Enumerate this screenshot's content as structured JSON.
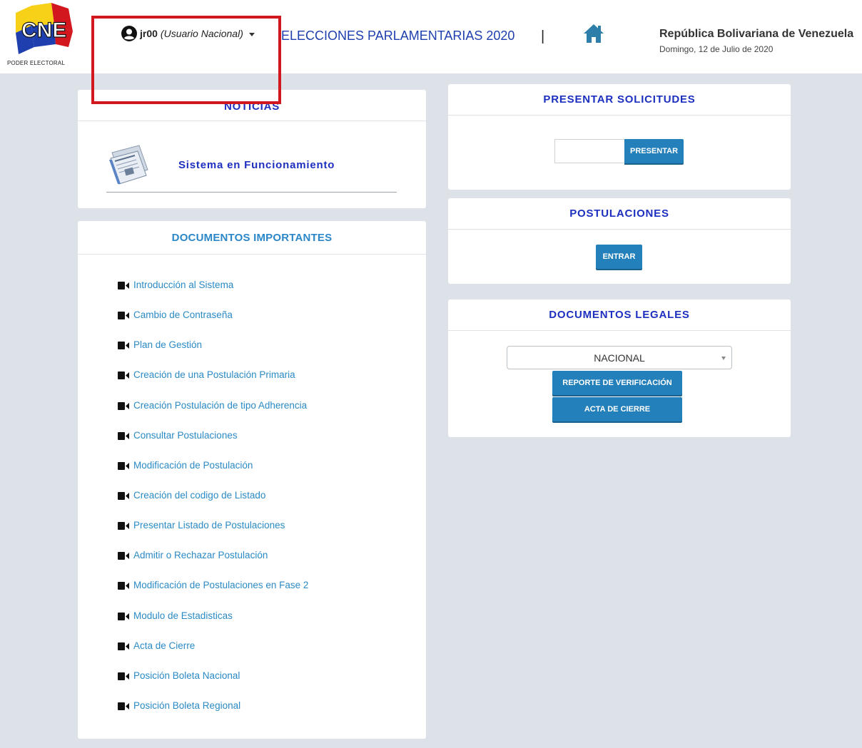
{
  "header": {
    "logo_text": "CNE",
    "logo_subtext": "PODER ELECTORAL",
    "user_name": "jr00",
    "user_role": "(Usuario Nacional)",
    "app_title": "ELECCIONES PARLAMENTARIAS 2020",
    "separator": "|",
    "country": "República Bolivariana de Venezuela",
    "date": "Domingo, 12 de Julio de 2020"
  },
  "noticias": {
    "title": "NOTICIAS",
    "item": "Sistema en Funcionamiento"
  },
  "documentos": {
    "title": "DOCUMENTOS IMPORTANTES",
    "items": [
      "Introducción al Sistema",
      "Cambio de Contraseña",
      "Plan de Gestión",
      "Creación de una Postulación Primaria",
      "Creación Postulación de tipo Adherencia",
      "Consultar Postulaciones",
      "Modificación de Postulación",
      "Creación del codigo de Listado",
      "Presentar Listado de Postulaciones",
      "Admitir o Rechazar Postulación",
      "Modificación de Postulaciones en Fase 2",
      "Modulo de Estadisticas",
      "Acta de Cierre",
      "Posición Boleta Nacional",
      "Posición Boleta Regional"
    ]
  },
  "solicitudes": {
    "title": "PRESENTAR SOLICITUDES",
    "input_value": "",
    "button": "PRESENTAR"
  },
  "postulaciones": {
    "title": "POSTULACIONES",
    "button": "ENTRAR"
  },
  "legales": {
    "title": "DOCUMENTOS LEGALES",
    "select_value": "NACIONAL",
    "report_button": "REPORTE DE VERIFICACIÓN",
    "acta_button": "ACTA DE CIERRE"
  },
  "colors": {
    "header_title": "#1f3fae",
    "panel_title": "#1d2fbf",
    "link": "#2a8ac5",
    "button": "#2480bb",
    "highlight": "#d2171f",
    "background": "#dde2e8"
  }
}
